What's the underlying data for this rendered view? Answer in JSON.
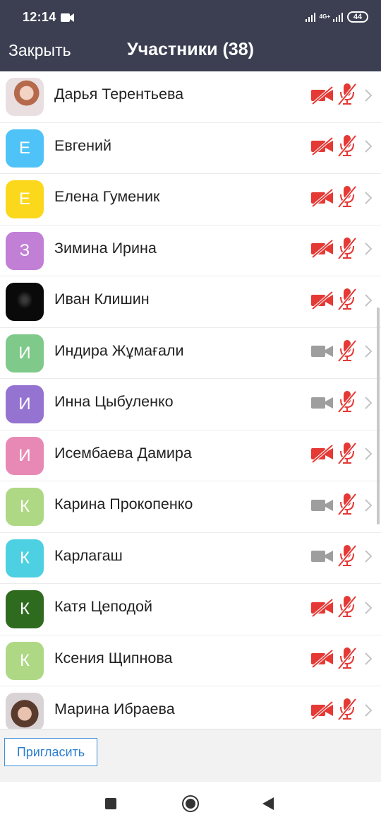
{
  "status_bar": {
    "time": "12:14",
    "network": "4G+",
    "battery": "44"
  },
  "header": {
    "close_label": "Закрыть",
    "title": "Участники (38)"
  },
  "participants": [
    {
      "name": "Дарья Терентьева",
      "initial": "",
      "avatar_color": "",
      "avatar_photo": "photo-girl1",
      "video": "off",
      "audio": "muted"
    },
    {
      "name": "Евгений",
      "initial": "Е",
      "avatar_color": "#4fc3f7",
      "avatar_photo": "",
      "video": "off",
      "audio": "muted"
    },
    {
      "name": "Елена Гуменик",
      "initial": "Е",
      "avatar_color": "#fbd81c",
      "avatar_photo": "",
      "video": "off",
      "audio": "muted"
    },
    {
      "name": "Зимина Ирина",
      "initial": "З",
      "avatar_color": "#c17fd6",
      "avatar_photo": "",
      "video": "off",
      "audio": "muted"
    },
    {
      "name": "Иван Клишин",
      "initial": "",
      "avatar_color": "",
      "avatar_photo": "photo-night",
      "video": "off",
      "audio": "muted"
    },
    {
      "name": "Индира Жұмағали",
      "initial": "И",
      "avatar_color": "#7fc98a",
      "avatar_photo": "",
      "video": "disabled",
      "audio": "muted"
    },
    {
      "name": "Инна Цыбуленко",
      "initial": "И",
      "avatar_color": "#9573d1",
      "avatar_photo": "",
      "video": "disabled",
      "audio": "muted"
    },
    {
      "name": "Исембаева Дамира",
      "initial": "И",
      "avatar_color": "#e889b5",
      "avatar_photo": "",
      "video": "off",
      "audio": "muted"
    },
    {
      "name": "Карина Прокопенко",
      "initial": "К",
      "avatar_color": "#aed884",
      "avatar_photo": "",
      "video": "disabled",
      "audio": "muted"
    },
    {
      "name": "Карлагаш",
      "initial": "К",
      "avatar_color": "#4dd0e1",
      "avatar_photo": "",
      "video": "disabled",
      "audio": "muted"
    },
    {
      "name": "Катя Цеподой",
      "initial": "К",
      "avatar_color": "#2f6b1f",
      "avatar_photo": "",
      "video": "off",
      "audio": "muted"
    },
    {
      "name": "Ксения Щипнова",
      "initial": "К",
      "avatar_color": "#aed884",
      "avatar_photo": "",
      "video": "off",
      "audio": "muted"
    },
    {
      "name": "Марина Ибраева",
      "initial": "",
      "avatar_color": "",
      "avatar_photo": "photo-girl2",
      "video": "off",
      "audio": "muted"
    }
  ],
  "footer": {
    "invite_label": "Пригласить"
  },
  "colors": {
    "header_bg": "#3b3f51",
    "muted_red": "#e53935",
    "video_disabled_gray": "#9e9e9e",
    "link_blue": "#2d7fd0"
  }
}
